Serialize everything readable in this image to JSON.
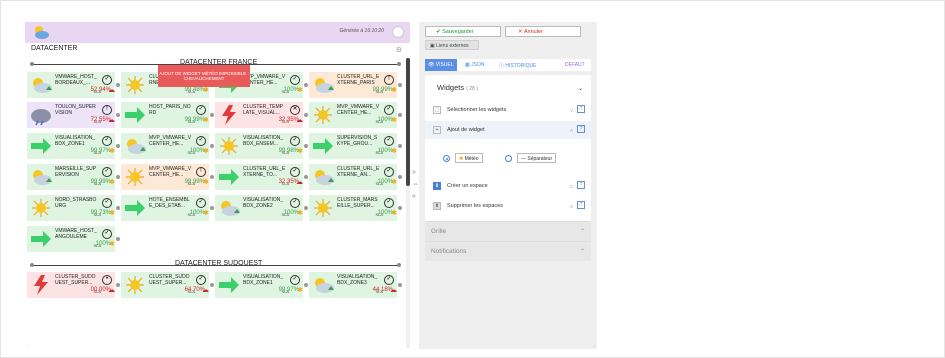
{
  "header": {
    "generated": "Générée à 16:10:20"
  },
  "main_title": "DATACENTER",
  "sections": [
    {
      "label": "DATACENTER FRANCE"
    },
    {
      "label": "DATACENTER SUDOUEST"
    }
  ],
  "warning": "AJOUT DE WIDGET MÉTÉO IMPOSSIBLE : CHEVAUCHEMENT",
  "tiles": [
    {
      "name": "VMWARE_HOST_ BORDEAUX_...",
      "sla": "SLA",
      "value": "52.94%",
      "status": "check"
    },
    {
      "name": "CLUSTER_... RNE...",
      "sla": "SLA",
      "value": "99.48%",
      "status": "check"
    },
    {
      "name": "MVP_VMWARE_V CENTER_HE...",
      "sla": "SLA",
      "value": "100%",
      "status": "check"
    },
    {
      "name": "CLUSTER_URL_E XTERNE_PARIS",
      "sla": "SLA",
      "value": "99.99%",
      "status": "warn"
    },
    {
      "name": "TOULON_SUPER VISION",
      "sla": "SLA",
      "value": "72.55%",
      "status": "warn"
    },
    {
      "name": "HOST_PARIS_NO RD",
      "sla": "SLA",
      "value": "99.99%",
      "status": "check"
    },
    {
      "name": "CLUSTER_TEMP LATE_VISUAL...",
      "sla": "SLA",
      "value": "32.35%",
      "status": "error"
    },
    {
      "name": "MVP_VMWARE_V CENTER_HE...",
      "sla": "SLA",
      "value": "100%",
      "status": "check"
    },
    {
      "name": "VISUALISATION_ BDX_ZONE1",
      "sla": "SLA",
      "value": "99.97%",
      "status": "check"
    },
    {
      "name": "MVP_VMWARE_V CENTER_HE...",
      "sla": "SLA",
      "value": "100%",
      "status": "check"
    },
    {
      "name": "VISUALISATION_ BDX_ENSEM...",
      "sla": "SLA",
      "value": "99.98%",
      "status": "check"
    },
    {
      "name": "SUPERVISION_S KYPE_GROU...",
      "sla": "SLA",
      "value": "100%",
      "status": "check"
    },
    {
      "name": "MARSEILLE_SUP ERVISION",
      "sla": "SLA",
      "value": "99.99%",
      "status": "check"
    },
    {
      "name": "MVP_VMWARE_V CENTER_HE...",
      "sla": "SLA",
      "value": "99.99%",
      "status": "warn"
    },
    {
      "name": "CLUSTER_URL_E XTERNE_TO...",
      "sla": "SLA",
      "value": "32.35%",
      "status": "check"
    },
    {
      "name": "CLUSTER_URL_E XTERNE_AN...",
      "sla": "SLA",
      "value": "100%",
      "status": "check"
    },
    {
      "name": "NORD_STRASBO URG",
      "sla": "SLA",
      "value": "99.73%",
      "status": "check"
    },
    {
      "name": "HOTE_ENSEMBL E_DES_ETAB...",
      "sla": "SLA",
      "value": "100%",
      "status": "check"
    },
    {
      "name": "VISUALISATION_ BDX_ZONE2",
      "sla": "SLA",
      "value": "100%",
      "status": "check"
    },
    {
      "name": "CLUSTER_MARS EILLE_SUPER...",
      "sla": "SLA",
      "value": "100%",
      "status": "check"
    },
    {
      "name": "VMWARE_HOST_ ANGOULEME",
      "sla": "SLA",
      "value": "100%",
      "status": "check"
    },
    {
      "name": "CLUSTER_SUDO UEST_SUPER...",
      "sla": "SLA",
      "value": "00.00%",
      "status": "neutral"
    },
    {
      "name": "CLUSTER_SUDO UEST_SUPER...",
      "sla": "SLA",
      "value": "64.70%",
      "status": "check"
    },
    {
      "name": "VISUALISATION_ BDX_ZONE1",
      "sla": "SLA",
      "value": "99.97%",
      "status": "check"
    },
    {
      "name": "VISUALISATION_ BDX_ZONE3",
      "sla": "SLA",
      "value": "44.18%",
      "status": "check"
    }
  ],
  "toolbar": {
    "save": "Sauvegarder",
    "cancel": "Annuler",
    "links": "Liens externes"
  },
  "tabs": [
    {
      "label": "VISUEL"
    },
    {
      "label": "JSON"
    },
    {
      "label": "HISTORIQUE"
    },
    {
      "label": "DÉFAUT"
    }
  ],
  "widgets": {
    "title": "Widgets",
    "count": "( 28 )",
    "items": [
      {
        "label": "Sélectionner les widgets",
        "key": "V",
        "help": "?"
      },
      {
        "label": "Ajout de widget",
        "key": "A",
        "help": "?"
      },
      {
        "label": "Créer un espace",
        "key": "C",
        "help": "?"
      },
      {
        "label": "Supprimer les espaces",
        "key": "S",
        "help": "?"
      }
    ],
    "options": [
      {
        "label": "Météo"
      },
      {
        "label": "Séparateur"
      }
    ]
  },
  "panels": [
    {
      "label": "Grille"
    },
    {
      "label": "Notifications"
    }
  ],
  "colors": {
    "header_bg": "#e8d6f2",
    "ok": "#3aa14a",
    "bad": "#d12020",
    "accent": "#5b8fe4"
  }
}
